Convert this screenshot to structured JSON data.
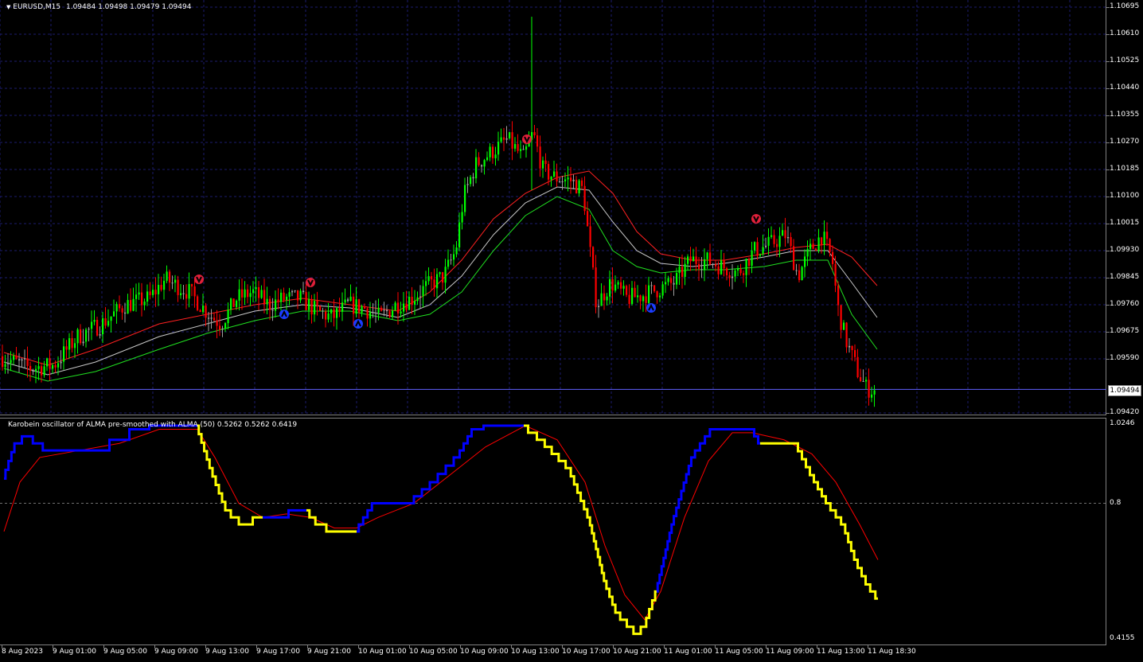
{
  "chart_title": "EURUSD,M15",
  "ohlc": "1.09484 1.09498 1.09479 1.09494",
  "symbol_menu_icon": "triangle-down-icon",
  "price_axis": [
    "1.10695",
    "1.10610",
    "1.10525",
    "1.10440",
    "1.10355",
    "1.10270",
    "1.10185",
    "1.10100",
    "1.10015",
    "1.09930",
    "1.09845",
    "1.09760",
    "1.09675",
    "1.09590",
    "1.09420"
  ],
  "current_price": "1.09494",
  "oscillator": {
    "title": "Karobein oscillator of ALMA pre-smoothed with ALMA  (50) 0.5262 0.5262 0.6419",
    "axis": [
      "1.0246",
      "0.8",
      "0.4155"
    ],
    "level": 0.8
  },
  "time_axis": [
    "8 Aug 2023",
    "9 Aug 01:00",
    "9 Aug 05:00",
    "9 Aug 09:00",
    "9 Aug 13:00",
    "9 Aug 17:00",
    "9 Aug 21:00",
    "10 Aug 01:00",
    "10 Aug 05:00",
    "10 Aug 09:00",
    "10 Aug 13:00",
    "10 Aug 17:00",
    "10 Aug 21:00",
    "11 Aug 01:00",
    "11 Aug 05:00",
    "11 Aug 09:00",
    "11 Aug 13:00",
    "11 Aug 18:30"
  ],
  "colors": {
    "background": "#000000",
    "grid": "#1c1c6e",
    "bull_candle": "#00ff00",
    "bear_candle": "#ff0000",
    "neutral_candle": "#a0a0a0",
    "ma_red": "#ff2020",
    "ma_white": "#c8c8c8",
    "ma_green": "#20e020",
    "osc_up": "#0000ff",
    "osc_down": "#ffff00",
    "signal": "#ff0000",
    "price_line": "#6060ff"
  },
  "chart_data": [
    {
      "type": "candlestick",
      "title": "EURUSD,M15",
      "ylim": [
        1.0942,
        1.10695
      ],
      "grid": true,
      "x_range": [
        "8 Aug 2023",
        "11 Aug 18:30"
      ],
      "path_points": [
        [
          0,
          1.096
        ],
        [
          20,
          1.0958
        ],
        [
          40,
          1.0956
        ],
        [
          70,
          1.0957
        ],
        [
          100,
          1.0966
        ],
        [
          130,
          1.097
        ],
        [
          160,
          1.0976
        ],
        [
          190,
          1.0978
        ],
        [
          210,
          1.0984
        ],
        [
          240,
          1.098
        ],
        [
          265,
          1.0973
        ],
        [
          280,
          1.097
        ],
        [
          300,
          1.0978
        ],
        [
          320,
          1.098
        ],
        [
          340,
          1.0976
        ],
        [
          360,
          1.0978
        ],
        [
          380,
          1.0978
        ],
        [
          400,
          1.0974
        ],
        [
          420,
          1.0972
        ],
        [
          440,
          1.0976
        ],
        [
          460,
          1.0975
        ],
        [
          480,
          1.0972
        ],
        [
          500,
          1.0976
        ],
        [
          520,
          1.0978
        ],
        [
          540,
          1.0982
        ],
        [
          560,
          1.0985
        ],
        [
          575,
          1.0993
        ],
        [
          585,
          1.101
        ],
        [
          600,
          1.102
        ],
        [
          620,
          1.1024
        ],
        [
          640,
          1.1028
        ],
        [
          660,
          1.1022
        ],
        [
          672,
          1.103
        ],
        [
          685,
          1.1018
        ],
        [
          700,
          1.1016
        ],
        [
          720,
          1.1015
        ],
        [
          735,
          1.1012
        ],
        [
          745,
          1.099
        ],
        [
          752,
          1.0976
        ],
        [
          770,
          1.0983
        ],
        [
          790,
          1.0978
        ],
        [
          810,
          1.0979
        ],
        [
          830,
          1.0981
        ],
        [
          850,
          1.0983
        ],
        [
          870,
          1.099
        ],
        [
          890,
          1.099
        ],
        [
          910,
          1.0988
        ],
        [
          930,
          1.0986
        ],
        [
          950,
          1.0993
        ],
        [
          970,
          1.0995
        ],
        [
          990,
          1.0998
        ],
        [
          1005,
          1.0985
        ],
        [
          1020,
          1.0993
        ],
        [
          1035,
          1.0998
        ],
        [
          1048,
          1.099
        ],
        [
          1055,
          1.0975
        ],
        [
          1065,
          1.0965
        ],
        [
          1080,
          1.0955
        ],
        [
          1090,
          1.095
        ],
        [
          1100,
          1.0949
        ]
      ],
      "moving_averages": [
        {
          "name": "",
          "color": "#ff2020",
          "points": [
            [
              5,
              1.0961
            ],
            [
              60,
              1.0957
            ],
            [
              120,
              1.0962
            ],
            [
              200,
              1.097
            ],
            [
              260,
              1.0973
            ],
            [
              320,
              1.0976
            ],
            [
              380,
              1.0978
            ],
            [
              440,
              1.0976
            ],
            [
              500,
              1.0974
            ],
            [
              540,
              1.098
            ],
            [
              580,
              1.099
            ],
            [
              620,
              1.1003
            ],
            [
              660,
              1.1011
            ],
            [
              700,
              1.1016
            ],
            [
              740,
              1.1018
            ],
            [
              770,
              1.1011
            ],
            [
              800,
              1.0999
            ],
            [
              830,
              1.0992
            ],
            [
              870,
              1.099
            ],
            [
              910,
              1.099
            ],
            [
              960,
              1.0992
            ],
            [
              1000,
              1.0994
            ],
            [
              1040,
              1.0995
            ],
            [
              1070,
              1.0991
            ],
            [
              1102,
              1.0982
            ]
          ]
        },
        {
          "name": "",
          "color": "#c8c8c8",
          "points": [
            [
              5,
              1.0958
            ],
            [
              60,
              1.0954
            ],
            [
              120,
              1.0958
            ],
            [
              200,
              1.0966
            ],
            [
              260,
              1.097
            ],
            [
              320,
              1.0974
            ],
            [
              380,
              1.0976
            ],
            [
              440,
              1.0975
            ],
            [
              500,
              1.0972
            ],
            [
              540,
              1.0976
            ],
            [
              580,
              1.0985
            ],
            [
              620,
              1.0998
            ],
            [
              660,
              1.1008
            ],
            [
              700,
              1.1013
            ],
            [
              740,
              1.1012
            ],
            [
              770,
              1.1002
            ],
            [
              800,
              1.0993
            ],
            [
              830,
              1.0989
            ],
            [
              870,
              1.0988
            ],
            [
              910,
              1.0989
            ],
            [
              960,
              1.0991
            ],
            [
              1000,
              1.0993
            ],
            [
              1040,
              1.0993
            ],
            [
              1070,
              1.0983
            ],
            [
              1102,
              1.0972
            ]
          ]
        },
        {
          "name": "",
          "color": "#20e020",
          "points": [
            [
              5,
              1.0956
            ],
            [
              60,
              1.0952
            ],
            [
              120,
              1.0955
            ],
            [
              200,
              1.0962
            ],
            [
              260,
              1.0967
            ],
            [
              320,
              1.0971
            ],
            [
              380,
              1.0974
            ],
            [
              440,
              1.0974
            ],
            [
              500,
              1.0971
            ],
            [
              540,
              1.0973
            ],
            [
              580,
              1.098
            ],
            [
              620,
              1.0993
            ],
            [
              660,
              1.1004
            ],
            [
              700,
              1.101
            ],
            [
              740,
              1.1006
            ],
            [
              770,
              1.0993
            ],
            [
              800,
              1.0988
            ],
            [
              830,
              1.0986
            ],
            [
              870,
              1.0987
            ],
            [
              910,
              1.0987
            ],
            [
              960,
              1.0988
            ],
            [
              1000,
              1.099
            ],
            [
              1040,
              1.099
            ],
            [
              1070,
              1.0973
            ],
            [
              1102,
              1.0962
            ]
          ]
        }
      ],
      "sell_arrows": [
        [
          250,
          1.0984
        ],
        [
          390,
          1.0983
        ],
        [
          662,
          1.1028
        ],
        [
          950,
          1.1003
        ]
      ],
      "buy_arrows": [
        [
          357,
          1.0973
        ],
        [
          450,
          1.097
        ],
        [
          818,
          1.0975
        ]
      ],
      "current_price": 1.09494
    },
    {
      "type": "line",
      "title": "Karobein oscillator of ALMA pre-smoothed with ALMA  (50) 0.5262 0.5262 0.6419",
      "ylim": [
        0.4155,
        1.0246
      ],
      "level": 0.8,
      "oscillator_points": [
        [
          5,
          0.87
        ],
        [
          20,
          0.97
        ],
        [
          35,
          0.99
        ],
        [
          60,
          0.95
        ],
        [
          125,
          0.95
        ],
        [
          150,
          0.98
        ],
        [
          175,
          1.01
        ],
        [
          200,
          1.02
        ],
        [
          248,
          1.02
        ],
        [
          265,
          0.9
        ],
        [
          285,
          0.78
        ],
        [
          305,
          0.74
        ],
        [
          330,
          0.76
        ],
        [
          355,
          0.76
        ],
        [
          370,
          0.78
        ],
        [
          385,
          0.78
        ],
        [
          400,
          0.74
        ],
        [
          420,
          0.72
        ],
        [
          448,
          0.72
        ],
        [
          470,
          0.8
        ],
        [
          515,
          0.8
        ],
        [
          545,
          0.86
        ],
        [
          575,
          0.93
        ],
        [
          595,
          1.01
        ],
        [
          620,
          1.02
        ],
        [
          658,
          1.02
        ],
        [
          680,
          0.98
        ],
        [
          715,
          0.9
        ],
        [
          740,
          0.76
        ],
        [
          760,
          0.58
        ],
        [
          775,
          0.49
        ],
        [
          800,
          0.43
        ],
        [
          810,
          0.45
        ],
        [
          825,
          0.55
        ],
        [
          845,
          0.74
        ],
        [
          870,
          0.93
        ],
        [
          895,
          1.01
        ],
        [
          945,
          1.01
        ],
        [
          955,
          0.97
        ],
        [
          1000,
          0.97
        ],
        [
          1020,
          0.88
        ],
        [
          1040,
          0.8
        ],
        [
          1060,
          0.74
        ],
        [
          1075,
          0.64
        ],
        [
          1090,
          0.57
        ],
        [
          1103,
          0.53
        ]
      ],
      "oscillator_colors": [
        "blue",
        "blue",
        "blue",
        "blue",
        "blue",
        "blue",
        "blue",
        "blue",
        "yellow",
        "yellow",
        "yellow",
        "yellow",
        "blue",
        "blue",
        "blue",
        "yellow",
        "yellow",
        "yellow",
        "blue",
        "blue",
        "blue",
        "blue",
        "blue",
        "blue",
        "blue",
        "yellow",
        "yellow",
        "yellow",
        "yellow",
        "yellow",
        "yellow",
        "yellow",
        "yellow",
        "blue",
        "blue",
        "blue",
        "blue",
        "blue",
        "yellow",
        "yellow",
        "yellow",
        "yellow",
        "yellow",
        "yellow",
        "yellow",
        "yellow"
      ],
      "signal_points": [
        [
          5,
          0.72
        ],
        [
          25,
          0.86
        ],
        [
          50,
          0.93
        ],
        [
          100,
          0.95
        ],
        [
          150,
          0.97
        ],
        [
          200,
          1.01
        ],
        [
          248,
          1.01
        ],
        [
          270,
          0.93
        ],
        [
          300,
          0.8
        ],
        [
          330,
          0.76
        ],
        [
          360,
          0.77
        ],
        [
          390,
          0.76
        ],
        [
          420,
          0.73
        ],
        [
          448,
          0.73
        ],
        [
          475,
          0.76
        ],
        [
          520,
          0.8
        ],
        [
          565,
          0.88
        ],
        [
          610,
          0.96
        ],
        [
          660,
          1.02
        ],
        [
          700,
          0.98
        ],
        [
          735,
          0.86
        ],
        [
          760,
          0.68
        ],
        [
          785,
          0.54
        ],
        [
          810,
          0.47
        ],
        [
          830,
          0.55
        ],
        [
          860,
          0.76
        ],
        [
          890,
          0.92
        ],
        [
          920,
          1.0
        ],
        [
          945,
          1.0
        ],
        [
          985,
          0.98
        ],
        [
          1020,
          0.94
        ],
        [
          1050,
          0.86
        ],
        [
          1080,
          0.74
        ],
        [
          1103,
          0.64
        ]
      ]
    }
  ]
}
